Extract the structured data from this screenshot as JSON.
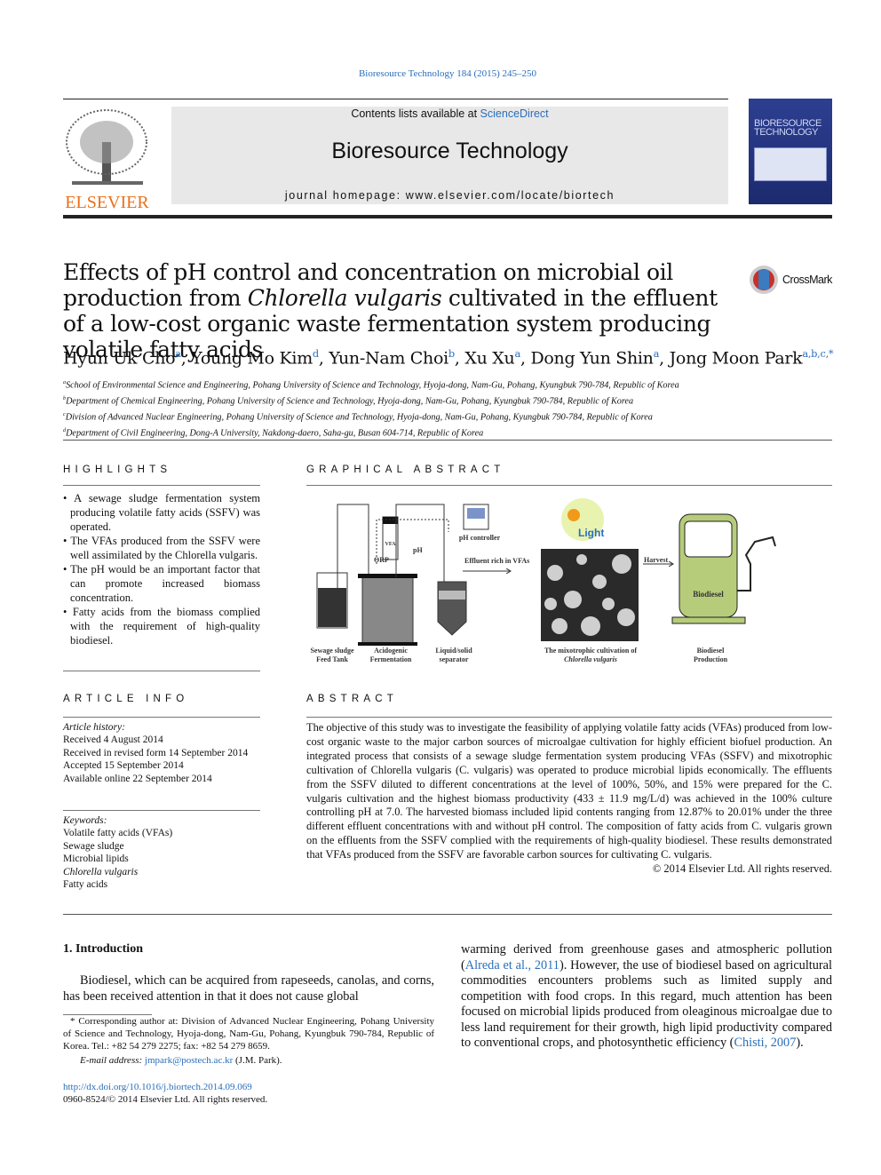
{
  "header": {
    "journal_reference": "Bioresource Technology 184 (2015) 245–250",
    "contents_prefix": "Contents lists available at ",
    "contents_link": "ScienceDirect",
    "journal_title": "Bioresource Technology",
    "homepage": "journal homepage: www.elsevier.com/locate/biortech",
    "publisher_logo": "ELSEVIER",
    "cover_title": "BIORESOURCE TECHNOLOGY"
  },
  "article": {
    "title_part1": "Effects of pH control and concentration on microbial oil production from ",
    "title_italic": "Chlorella vulgaris",
    "title_part2": " cultivated in the effluent of a low-cost organic waste fermentation system producing volatile fatty acids",
    "crossmark": "CrossMark",
    "authors": [
      {
        "name": "Hyun Uk Cho",
        "aff": "a"
      },
      {
        "name": "Young Mo Kim",
        "aff": "d"
      },
      {
        "name": "Yun-Nam Choi",
        "aff": "b"
      },
      {
        "name": "Xu Xu",
        "aff": "a"
      },
      {
        "name": "Dong Yun Shin",
        "aff": "a"
      },
      {
        "name": "Jong Moon Park",
        "aff": "a,b,c,*"
      }
    ],
    "affiliations": [
      {
        "label": "a",
        "text": "School of Environmental Science and Engineering, Pohang University of Science and Technology, Hyoja-dong, Nam-Gu, Pohang, Kyungbuk 790-784, Republic of Korea"
      },
      {
        "label": "b",
        "text": "Department of Chemical Engineering, Pohang University of Science and Technology, Hyoja-dong, Nam-Gu, Pohang, Kyungbuk 790-784, Republic of Korea"
      },
      {
        "label": "c",
        "text": "Division of Advanced Nuclear Engineering, Pohang University of Science and Technology, Hyoja-dong, Nam-Gu, Pohang, Kyungbuk 790-784, Republic of Korea"
      },
      {
        "label": "d",
        "text": "Department of Civil Engineering, Dong-A University, Nakdong-daero, Saha-gu, Busan 604-714, Republic of Korea"
      }
    ]
  },
  "highlights": {
    "heading": "HIGHLIGHTS",
    "items": [
      "A sewage sludge fermentation system producing volatile fatty acids (SSFV) was operated.",
      "The VFAs produced from the SSFV were well assimilated by the Chlorella vulgaris.",
      "The pH would be an important factor that can promote increased biomass concentration.",
      "Fatty acids from the biomass complied with the requirement of high-quality biodiesel."
    ]
  },
  "graphical_abstract": {
    "heading": "GRAPHICAL ABSTRACT",
    "labels": {
      "feed_tank": "Sewage sludge Feed Tank",
      "fermentation": "Acidogenic Fermentation",
      "separator": "Liquid/solid separator",
      "ph_controller": "pH controller",
      "vfa_box": "VFA",
      "orp": "ORP",
      "ph": "pH",
      "effluent": "Effluent rich in VFAs",
      "light": "Light",
      "cultivation": "The mixotrophic cultivation of",
      "cultivation_species": "Chlorella vulgaris",
      "harvest": "Harvest",
      "biodiesel": "Biodiesel",
      "production": "Biodiesel Production"
    }
  },
  "article_info": {
    "heading": "ARTICLE INFO",
    "history_label": "Article history:",
    "history": [
      "Received 4 August 2014",
      "Received in revised form 14 September 2014",
      "Accepted 15 September 2014",
      "Available online 22 September 2014"
    ],
    "keywords_label": "Keywords:",
    "keywords": [
      "Volatile fatty acids (VFAs)",
      "Sewage sludge",
      "Microbial lipids",
      "Chlorella vulgaris",
      "Fatty acids"
    ]
  },
  "abstract": {
    "heading": "ABSTRACT",
    "text": "The objective of this study was to investigate the feasibility of applying volatile fatty acids (VFAs) produced from low-cost organic waste to the major carbon sources of microalgae cultivation for highly efficient biofuel production. An integrated process that consists of a sewage sludge fermentation system producing VFAs (SSFV) and mixotrophic cultivation of Chlorella vulgaris (C. vulgaris) was operated to produce microbial lipids economically. The effluents from the SSFV diluted to different concentrations at the level of 100%, 50%, and 15% were prepared for the C. vulgaris cultivation and the highest biomass productivity (433 ± 11.9 mg/L/d) was achieved in the 100% culture controlling pH at 7.0. The harvested biomass included lipid contents ranging from 12.87% to 20.01% under the three different effluent concentrations with and without pH control. The composition of fatty acids from C. vulgaris grown on the effluents from the SSFV complied with the requirements of high-quality biodiesel. These results demonstrated that VFAs produced from the SSFV are favorable carbon sources for cultivating C. vulgaris.",
    "copyright": "© 2014 Elsevier Ltd. All rights reserved."
  },
  "introduction": {
    "heading": "1. Introduction",
    "para1": "Biodiesel, which can be acquired from rapeseeds, canolas, and corns, has been received attention in that it does not cause global",
    "para2_a": "warming derived from greenhouse gases and atmospheric pollution (",
    "cite1": "Alreda et al., 2011",
    "para2_b": "). However, the use of biodiesel based on agricultural commodities encounters problems such as limited supply and competition with food crops. In this regard, much attention has been focused on microbial lipids produced from oleaginous microalgae due to less land requirement for their growth, high lipid productivity compared to conventional crops, and photosynthetic efficiency (",
    "cite2": "Chisti, 2007",
    "para2_c": ")."
  },
  "footnote": {
    "corresponding": "Corresponding author at: Division of Advanced Nuclear Engineering, Pohang University of Science and Technology, Hyoja-dong, Nam-Gu, Pohang, Kyungbuk 790-784, Republic of Korea. Tel.: +82 54 279 2275; fax: +82 54 279 8659.",
    "email_label": "E-mail address:",
    "email": "jmpark@postech.ac.kr",
    "email_suffix": " (J.M. Park).",
    "doi": "http://dx.doi.org/10.1016/j.biortech.2014.09.069",
    "issn": "0960-8524/© 2014 Elsevier Ltd. All rights reserved."
  },
  "colors": {
    "link": "#2a6ebb",
    "elsevier_orange": "#e9711c",
    "header_gray": "#e8e8e8",
    "cover_blue": "#2d3f91"
  }
}
